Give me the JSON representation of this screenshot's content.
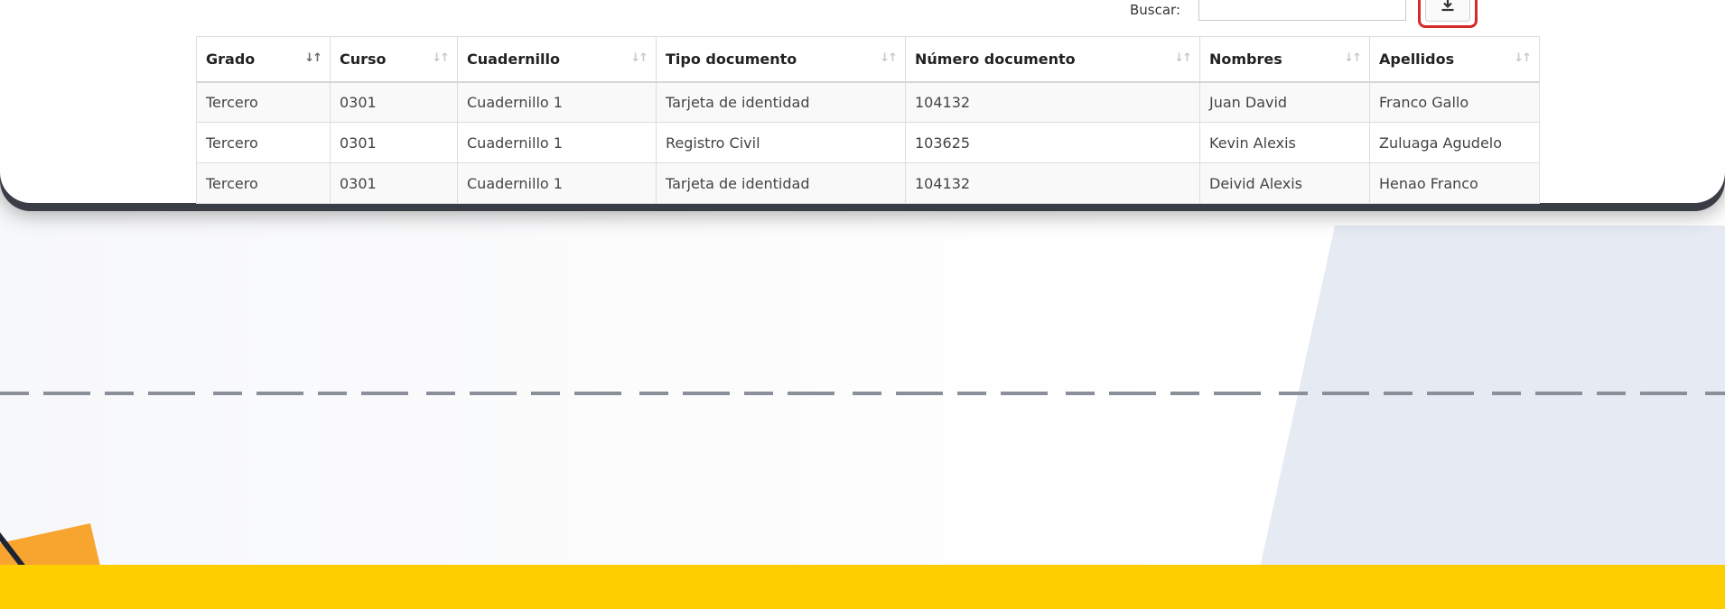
{
  "search": {
    "label": "Buscar:",
    "value": ""
  },
  "download": {
    "icon": "download-icon"
  },
  "table": {
    "columns": [
      {
        "label": "Grado",
        "sort": "sorted-asc"
      },
      {
        "label": "Curso",
        "sort": "sortable"
      },
      {
        "label": "Cuadernillo",
        "sort": "sortable"
      },
      {
        "label": "Tipo documento",
        "sort": "sortable"
      },
      {
        "label": "Número documento",
        "sort": "sortable"
      },
      {
        "label": "Nombres",
        "sort": "sortable"
      },
      {
        "label": "Apellidos",
        "sort": "sortable"
      }
    ],
    "rows": [
      [
        "Tercero",
        "0301",
        "Cuadernillo 1",
        "Tarjeta de identidad",
        "104132",
        "Juan David",
        "Franco Gallo"
      ],
      [
        "Tercero",
        "0301",
        "Cuadernillo 1",
        "Registro Civil",
        "103625",
        "Kevin Alexis",
        "Zuluaga Agudelo"
      ],
      [
        "Tercero",
        "0301",
        "Cuadernillo 1",
        "Tarjeta de identidad",
        "104132",
        "Deivid Alexis",
        "Henao Franco"
      ]
    ]
  },
  "colors": {
    "highlight": "#d52a2a",
    "accent_yellow": "#ffce00",
    "accent_orange": "#f8a52f",
    "panel_shadow": "#3a3d46",
    "background_blue": "#e6ebf3"
  }
}
